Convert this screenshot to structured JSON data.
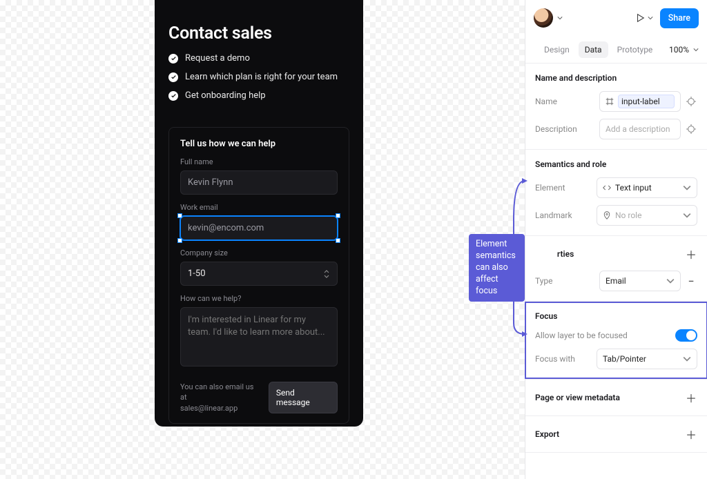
{
  "canvas": {
    "contact": {
      "title": "Contact sales",
      "bullets": [
        "Request a demo",
        "Learn which plan is right for your team",
        "Get onboarding help"
      ],
      "form": {
        "heading": "Tell us how we can help",
        "full_name_label": "Full name",
        "full_name_value": "Kevin Flynn",
        "work_email_label": "Work email",
        "work_email_value": "kevin@encom.com",
        "company_size_label": "Company size",
        "company_size_value": "1-50",
        "help_label": "How can we help?",
        "help_placeholder": "I'm interested in Linear for my team. I'd like to learn more about...",
        "footer_hint_1": "You can also email us at",
        "footer_hint_2": "sales@linear.app",
        "send_label": "Send message"
      }
    },
    "tooltip": "Element semantics can also affect focus"
  },
  "inspector": {
    "top": {
      "share_label": "Share"
    },
    "tabs": {
      "design": "Design",
      "data": "Data",
      "prototype": "Prototype",
      "zoom": "100%"
    },
    "name_desc": {
      "heading": "Name and description",
      "name_label": "Name",
      "name_value": "input-label",
      "desc_label": "Description",
      "desc_placeholder": "Add a description"
    },
    "semantics": {
      "heading": "Semantics and role",
      "element_label": "Element",
      "element_value": "Text input",
      "landmark_label": "Landmark",
      "landmark_value": "No role"
    },
    "properties": {
      "heading_suffix": "rties",
      "type_label": "Type",
      "type_value": "Email"
    },
    "focus": {
      "heading": "Focus",
      "allow_label": "Allow layer to be focused",
      "focus_with_label": "Focus with",
      "focus_with_value": "Tab/Pointer"
    },
    "collapsed": {
      "page_meta": "Page or view metadata",
      "export": "Export"
    }
  }
}
